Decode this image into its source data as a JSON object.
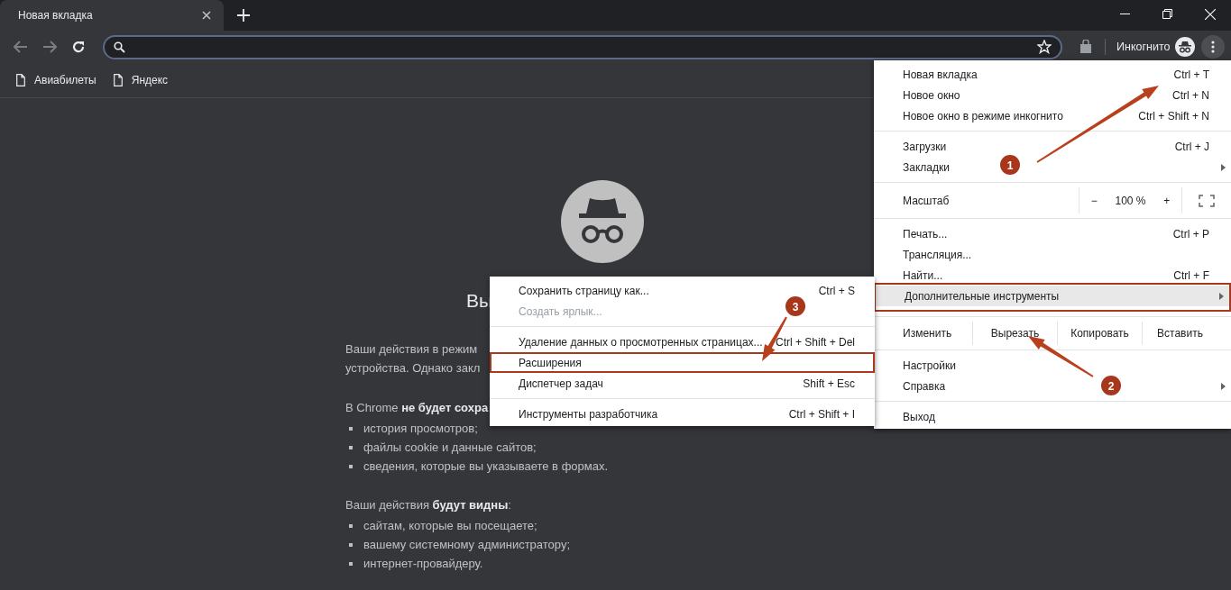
{
  "tab": {
    "title": "Новая вкладка",
    "selected": true
  },
  "bookmarks": [
    {
      "label": "Авиабилеты"
    },
    {
      "label": "Яндекс"
    }
  ],
  "profile": {
    "label": "Инкогнито"
  },
  "page": {
    "title": "Вы",
    "blocks": [
      {
        "kind": "para",
        "lines": [
          "Ваши действия в режим",
          "устройства. Однако закл"
        ]
      },
      {
        "kind": "para",
        "lines": [
          "В Chrome **не будет сохра**"
        ]
      },
      {
        "kind": "list",
        "items": [
          "история просмотров;",
          "файлы cookie и данные сайтов;",
          "сведения, которые вы указываете в формах."
        ]
      },
      {
        "kind": "para",
        "lines": [
          "Ваши действия **будут видны**:"
        ]
      },
      {
        "kind": "list",
        "items": [
          "сайтам, которые вы посещаете;",
          "вашему системному администратору;",
          "интернет-провайдеру."
        ]
      }
    ]
  },
  "menu": {
    "groups": [
      [
        {
          "kind": "item",
          "label": "Новая вкладка",
          "shortcut": "Ctrl + T",
          "submenu": false,
          "selected": false,
          "outlined": false
        },
        {
          "kind": "item",
          "label": "Новое окно",
          "shortcut": "Ctrl + N",
          "submenu": false,
          "selected": false,
          "outlined": false
        },
        {
          "kind": "item",
          "label": "Новое окно в режиме инкогнито",
          "shortcut": "Ctrl + Shift + N",
          "submenu": false,
          "selected": false,
          "outlined": false
        }
      ],
      [
        {
          "kind": "item",
          "label": "Загрузки",
          "shortcut": "Ctrl + J",
          "submenu": false,
          "selected": false,
          "outlined": false
        },
        {
          "kind": "item",
          "label": "Закладки",
          "submenu": true,
          "selected": false,
          "outlined": false
        }
      ],
      [
        {
          "kind": "zoom",
          "label": "Масштаб",
          "minus": "−",
          "value": "100 %",
          "plus": "+"
        }
      ],
      [
        {
          "kind": "item",
          "label": "Печать...",
          "shortcut": "Ctrl + P",
          "submenu": false,
          "selected": false,
          "outlined": false
        },
        {
          "kind": "item",
          "label": "Трансляция...",
          "submenu": false,
          "selected": false,
          "outlined": false
        },
        {
          "kind": "item",
          "label": "Найти...",
          "shortcut": "Ctrl + F",
          "submenu": false,
          "selected": false,
          "outlined": false
        },
        {
          "kind": "item",
          "label": "Дополнительные инструменты",
          "submenu": true,
          "selected": true,
          "outlined": true
        }
      ],
      [
        {
          "kind": "edit",
          "label": "Изменить",
          "actions": [
            "Вырезать",
            "Копировать",
            "Вставить"
          ]
        }
      ],
      [
        {
          "kind": "item",
          "label": "Настройки",
          "submenu": false,
          "selected": false,
          "outlined": false
        },
        {
          "kind": "item",
          "label": "Справка",
          "submenu": true,
          "selected": false,
          "outlined": false
        }
      ],
      [
        {
          "kind": "item",
          "label": "Выход",
          "submenu": false,
          "selected": false,
          "outlined": false
        }
      ]
    ]
  },
  "submenu": {
    "groups": [
      [
        {
          "label": "Сохранить страницу как...",
          "shortcut": "Ctrl + S",
          "disabled": false,
          "outlined": false
        },
        {
          "label": "Создать ярлык...",
          "disabled": true,
          "outlined": false
        }
      ],
      [
        {
          "label": "Удаление данных о просмотренных страницах...",
          "shortcut": "Ctrl + Shift + Del",
          "disabled": false,
          "outlined": false
        },
        {
          "label": "Расширения",
          "disabled": false,
          "outlined": true
        },
        {
          "label": "Диспетчер задач",
          "shortcut": "Shift + Esc",
          "disabled": false,
          "outlined": false
        }
      ],
      [
        {
          "label": "Инструменты разработчика",
          "shortcut": "Ctrl + Shift + I",
          "disabled": false,
          "outlined": false
        }
      ]
    ]
  },
  "annotations": [
    {
      "number": "1"
    },
    {
      "number": "2"
    },
    {
      "number": "3"
    }
  ]
}
